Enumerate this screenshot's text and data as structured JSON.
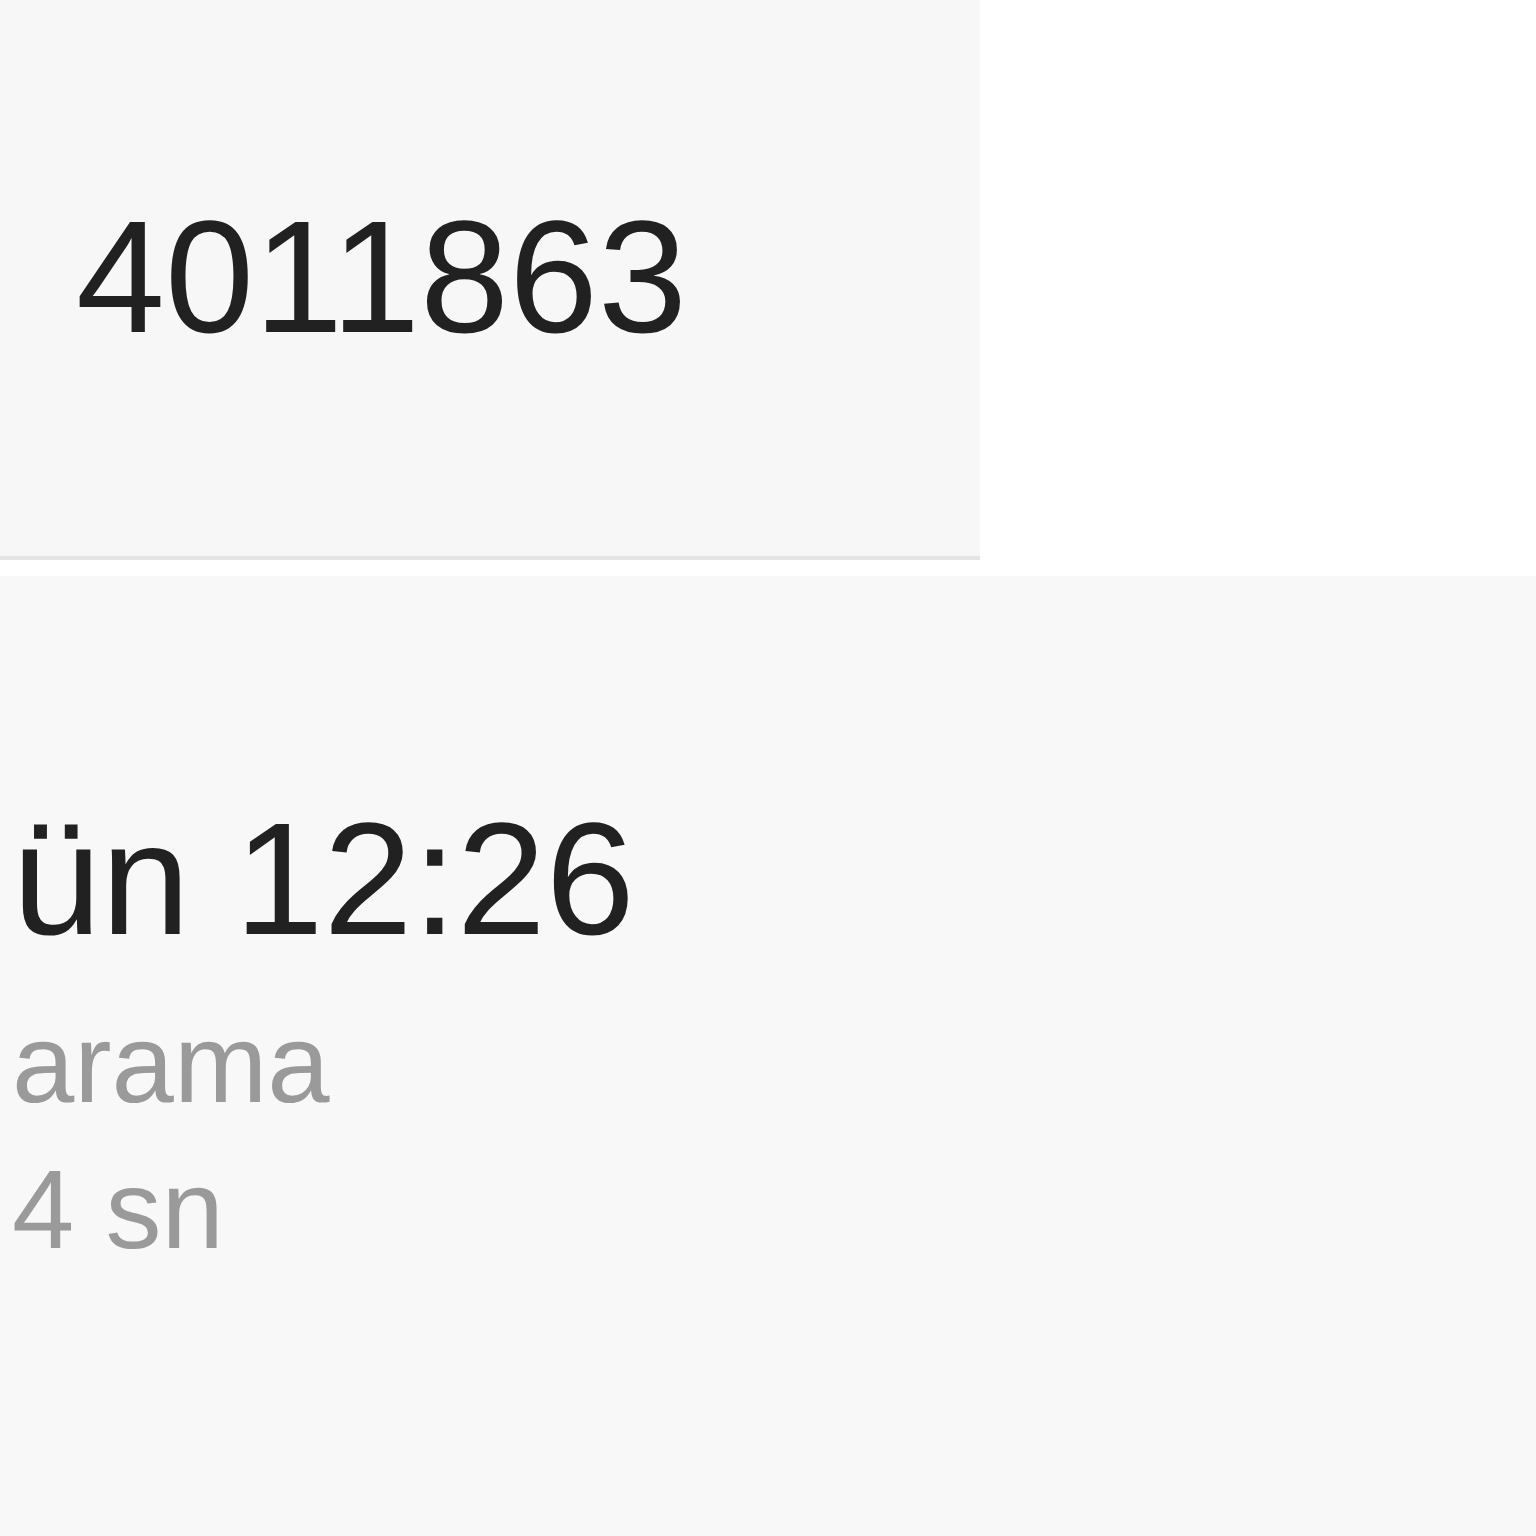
{
  "number_panel": {
    "number": "4011863"
  },
  "call_details": {
    "time": "ün 12:26",
    "type": "arama",
    "duration": "4 sn"
  }
}
